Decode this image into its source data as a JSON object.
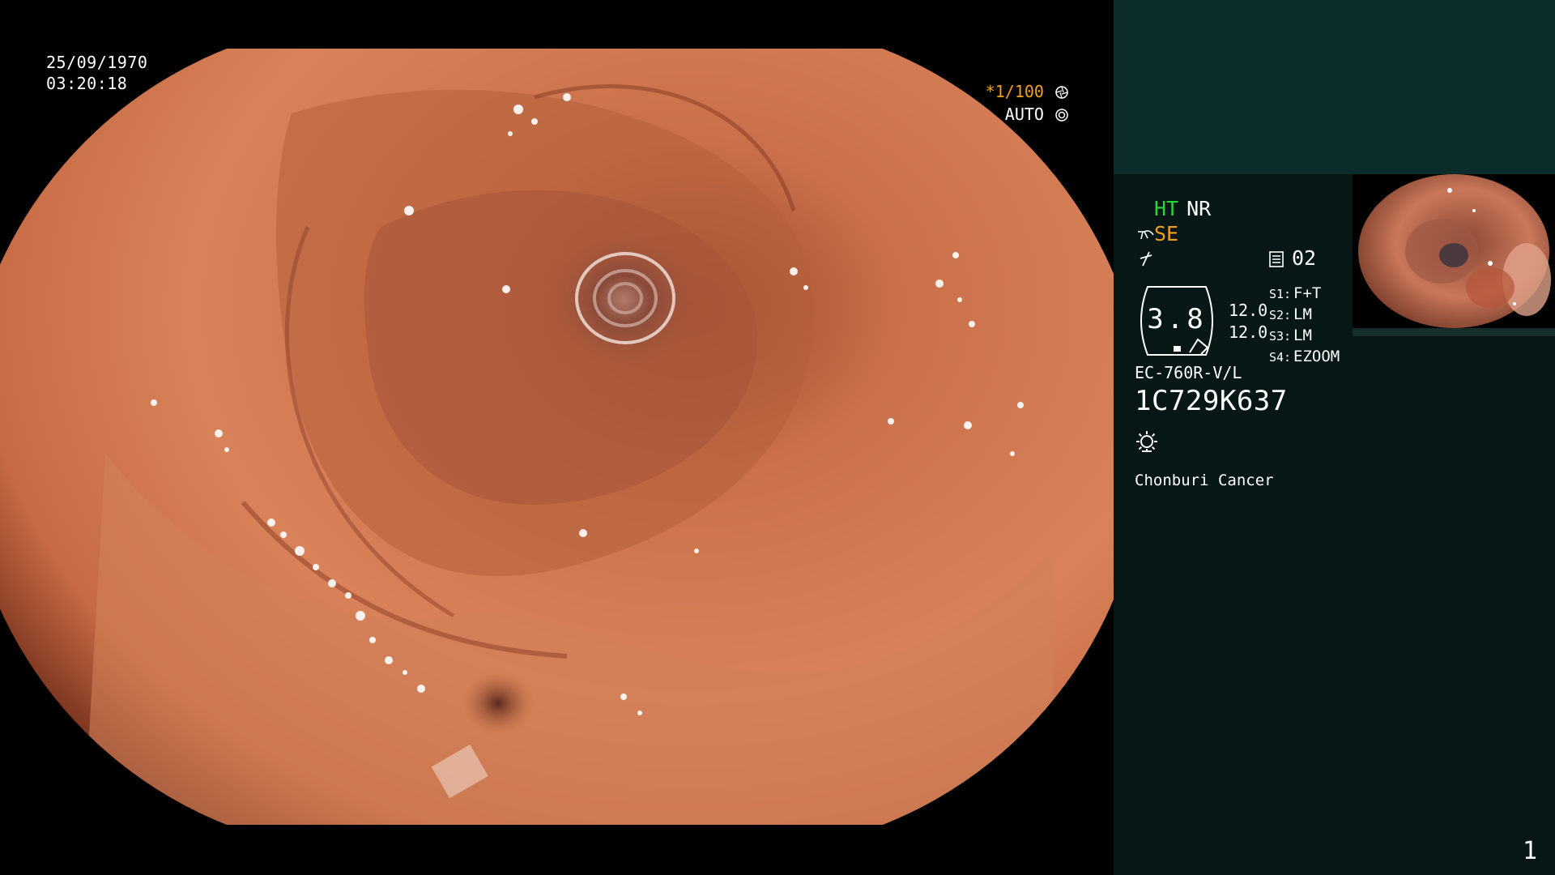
{
  "overlay": {
    "date": "25/09/1970",
    "time": "03:20:18",
    "shutter": "*1/100",
    "mode": "AUTO"
  },
  "panel": {
    "ht": "HT",
    "nr": "NR",
    "se": "SE",
    "memory": "02",
    "dial_value": "3.8",
    "readings": [
      "12.0",
      "12.0"
    ],
    "switches": [
      {
        "key": "S1:",
        "value": "F+T"
      },
      {
        "key": "S2:",
        "value": "LM"
      },
      {
        "key": "S3:",
        "value": "LM"
      },
      {
        "key": "S4:",
        "value": "EZOOM"
      }
    ],
    "scope_model": "EC-760R-V/L",
    "serial": "1C729K637",
    "site": "Chonburi Cancer",
    "page": "1"
  },
  "colors": {
    "accent_green": "#2fd23a",
    "accent_orange": "#f0a020",
    "panel_bg": "#061716",
    "panel_header_bg": "#0c2b2b"
  },
  "icons": [
    "shutter-aperture-icon",
    "auto-iris-icon",
    "fiber-icon",
    "flash-icon",
    "memory-icon",
    "light-source-icon"
  ]
}
